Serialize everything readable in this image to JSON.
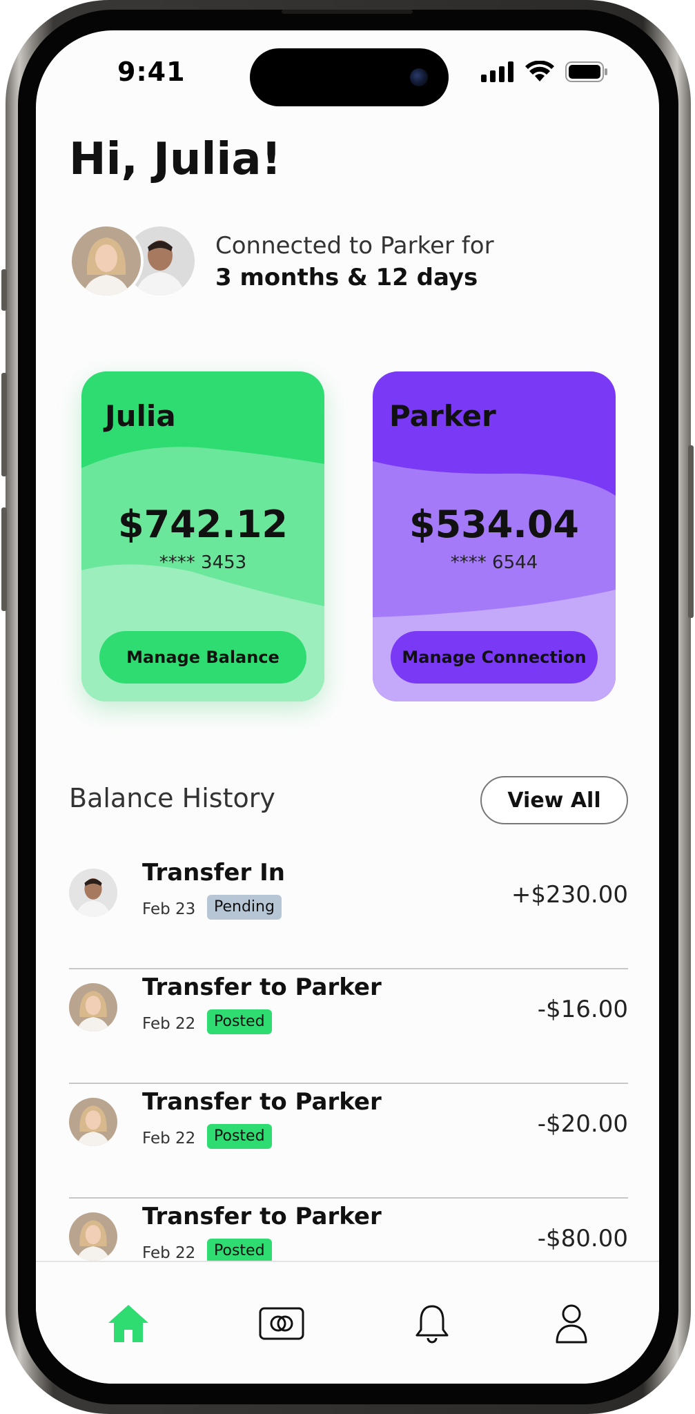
{
  "status_bar": {
    "time": "9:41"
  },
  "header": {
    "greeting": "Hi, Julia!"
  },
  "connection": {
    "line1": "Connected to Parker for",
    "line2": "3 months & 12 days"
  },
  "cards": [
    {
      "name": "Julia",
      "amount": "$742.12",
      "number": "**** 3453",
      "button_label": "Manage Balance",
      "color": "#2fdc72"
    },
    {
      "name": "Parker",
      "amount": "$534.04",
      "number": "**** 6544",
      "button_label": "Manage Connection",
      "color": "#7a3af5"
    }
  ],
  "history": {
    "title": "Balance History",
    "view_all_label": "View All",
    "transactions": [
      {
        "title": "Transfer In",
        "date": "Feb 23",
        "status": "Pending",
        "amount": "+$230.00",
        "avatar": "parker"
      },
      {
        "title": "Transfer to Parker",
        "date": "Feb 22",
        "status": "Posted",
        "amount": "-$16.00",
        "avatar": "julia"
      },
      {
        "title": "Transfer to Parker",
        "date": "Feb 22",
        "status": "Posted",
        "amount": "-$20.00",
        "avatar": "julia"
      },
      {
        "title": "Transfer to Parker",
        "date": "Feb 22",
        "status": "Posted",
        "amount": "-$80.00",
        "avatar": "julia"
      }
    ]
  },
  "tab_bar": {
    "items": [
      {
        "icon": "home-icon",
        "active": true
      },
      {
        "icon": "card-icon",
        "active": false
      },
      {
        "icon": "bell-icon",
        "active": false
      },
      {
        "icon": "profile-icon",
        "active": false
      }
    ],
    "active_color": "#2fdc72"
  }
}
